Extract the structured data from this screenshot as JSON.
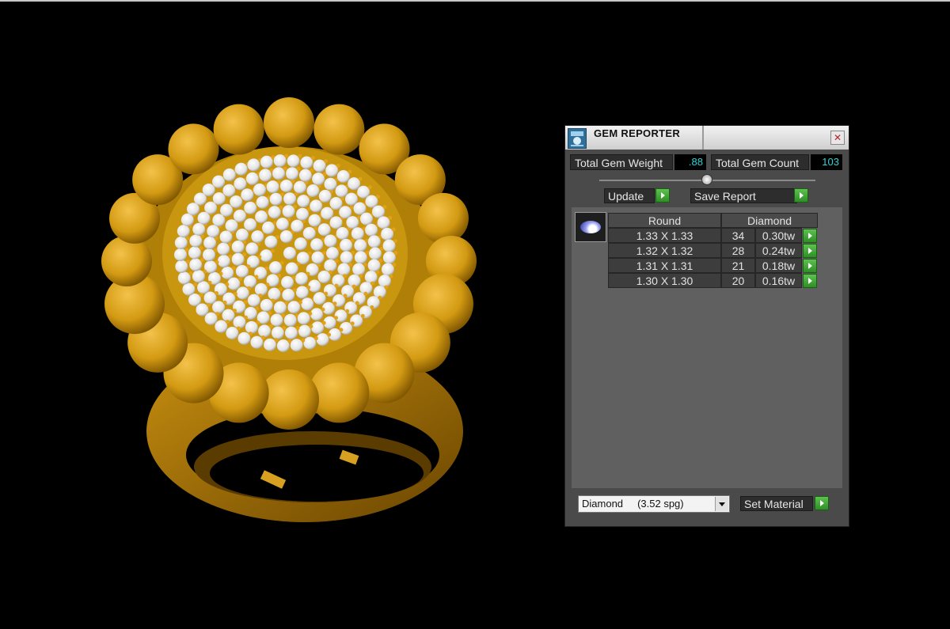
{
  "panel": {
    "title": "GEM REPORTER",
    "close_label": "✕",
    "total_weight_label": "Total Gem Weight",
    "total_weight_value": ".88",
    "total_count_label": "Total Gem Count",
    "total_count_value": "103",
    "update_label": "Update",
    "save_report_label": "Save Report",
    "table": {
      "headers": [
        "Round",
        "Diamond"
      ],
      "rows": [
        {
          "size": "1.33 X 1.33",
          "count": "34",
          "weight": "0.30tw"
        },
        {
          "size": "1.32 X 1.32",
          "count": "28",
          "weight": "0.24tw"
        },
        {
          "size": "1.31 X 1.31",
          "count": "21",
          "weight": "0.18tw"
        },
        {
          "size": "1.30 X 1.30",
          "count": "20",
          "weight": "0.16tw"
        }
      ]
    },
    "material_select": "Diamond     (3.52 spg)",
    "set_material_label": "Set Material"
  },
  "colors": {
    "background": "#000000",
    "gold": "#d49a10",
    "panel_bg": "#4a4a4a",
    "value_text": "#2fd3d3",
    "play_green": "#3aa52f"
  }
}
